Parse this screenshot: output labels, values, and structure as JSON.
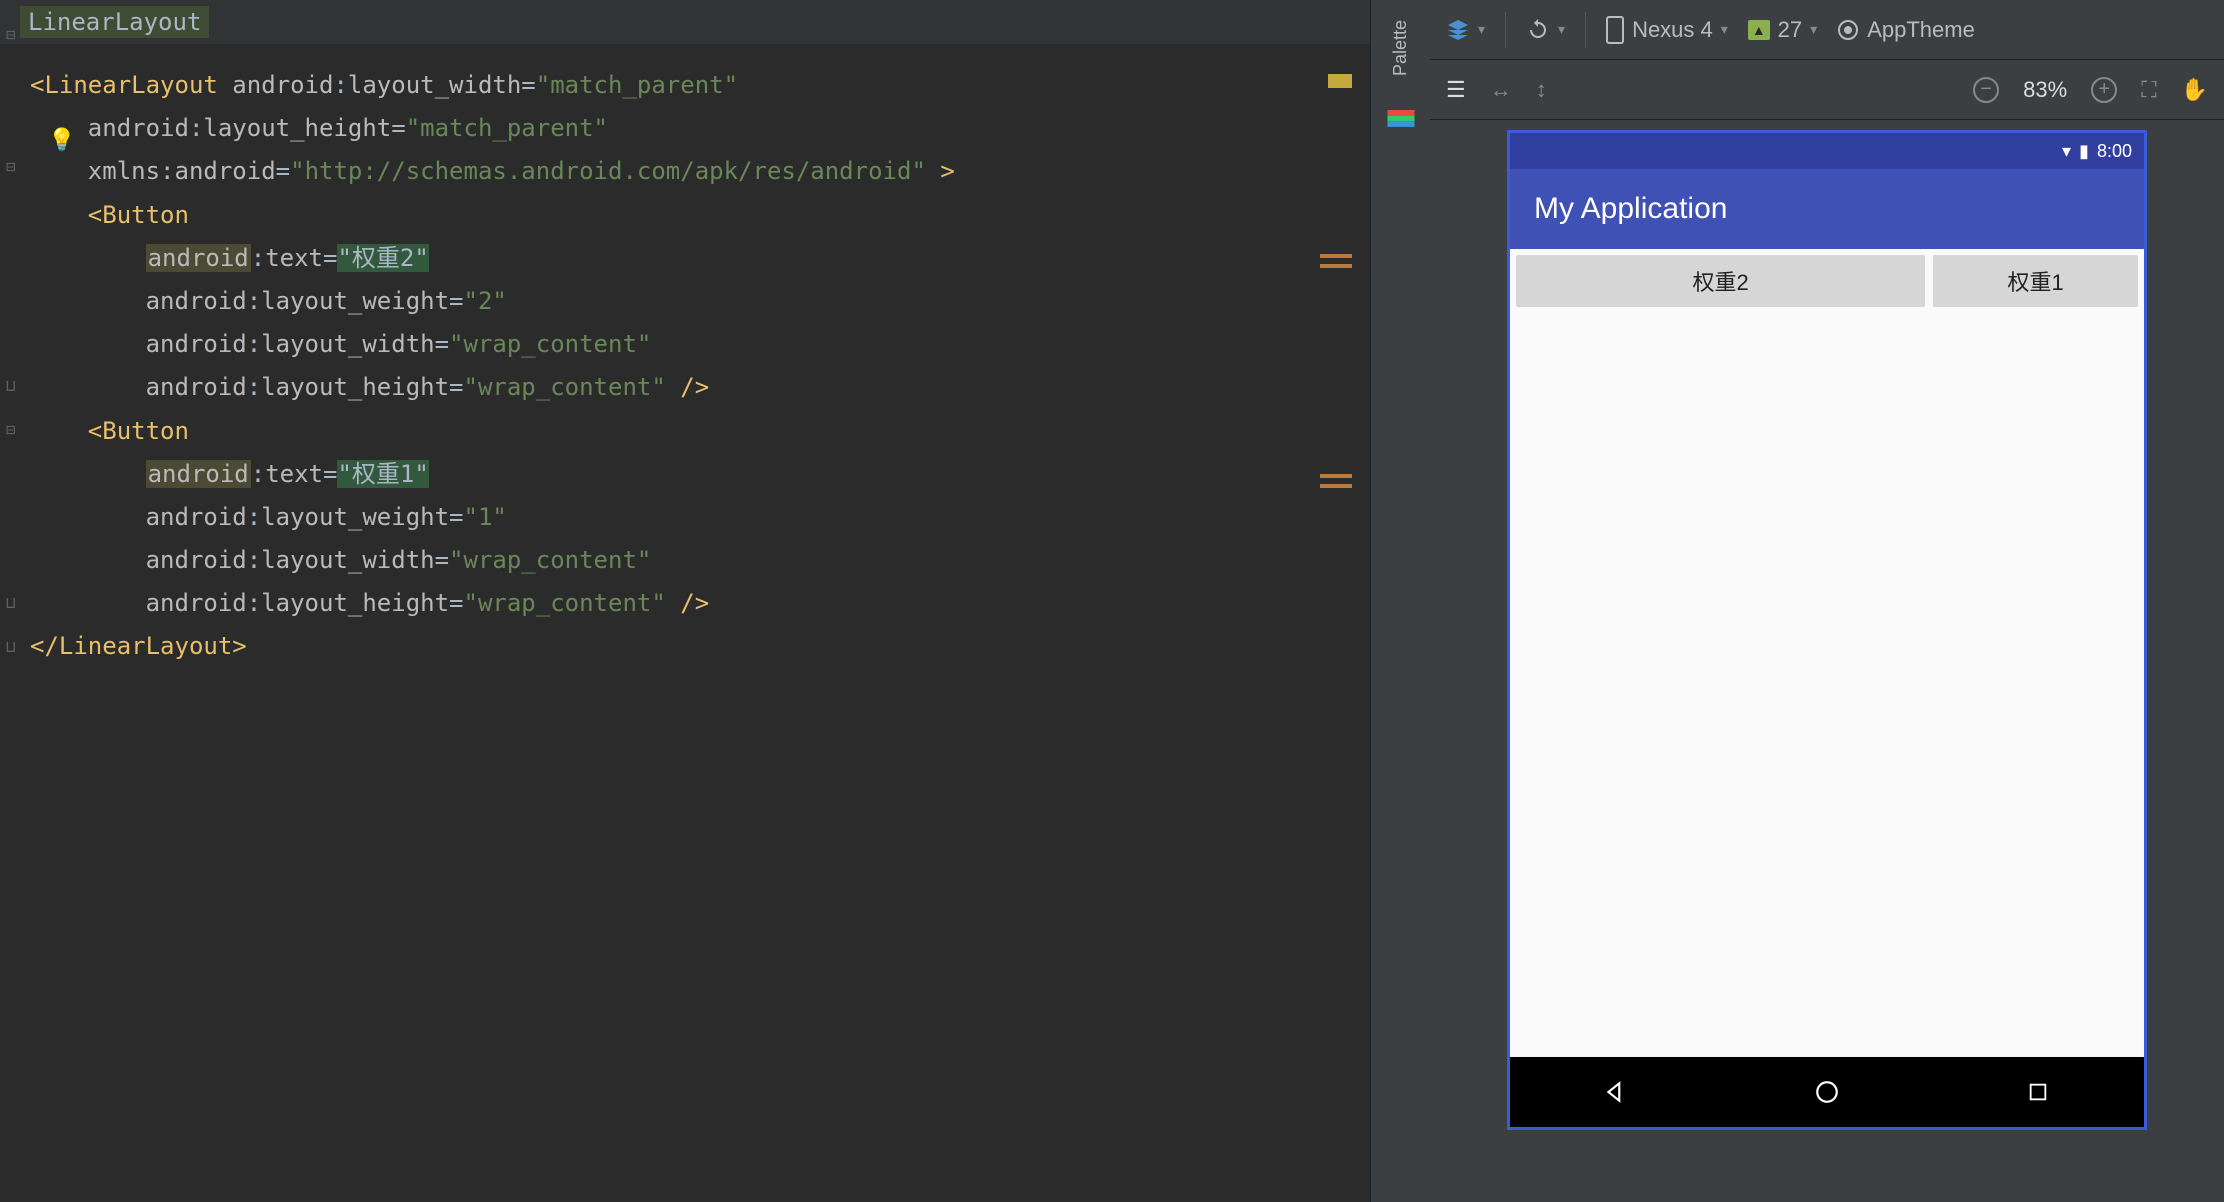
{
  "breadcrumb": "LinearLayout",
  "code": {
    "root_tag": "LinearLayout",
    "root_close": "</LinearLayout>",
    "xmlns_attr": "xmlns",
    "xmlns_prefix": "android",
    "xmlns_val": "http://schemas.android.com/apk/res/android",
    "ns": "android",
    "attrs": {
      "layout_width": "layout_width",
      "layout_height": "layout_height",
      "layout_weight": "layout_weight",
      "text": "text"
    },
    "vals": {
      "match_parent": "match_parent",
      "wrap_content": "wrap_content",
      "weight2": "2",
      "weight1": "1",
      "text2": "权重2",
      "text1": "权重1"
    },
    "button_tag": "Button"
  },
  "toolbar": {
    "device": "Nexus 4",
    "api": "27",
    "theme": "AppTheme"
  },
  "controls": {
    "zoom": "83%"
  },
  "device": {
    "time": "8:00",
    "app_title": "My Application",
    "button1_text": "权重2",
    "button2_text": "权重1"
  },
  "palette_label": "Palette"
}
